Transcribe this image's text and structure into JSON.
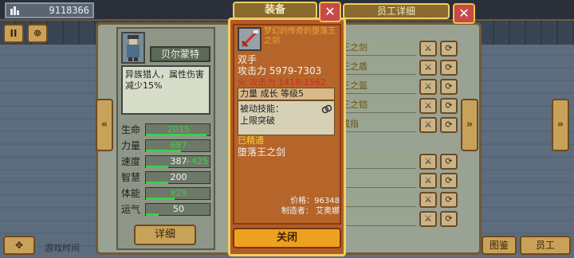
{
  "topbar": {
    "gold": "9118366",
    "gold_icon": "coins-icon"
  },
  "left_buttons": {
    "pause": "II",
    "settings": "☸"
  },
  "hero": {
    "name": "贝尔蒙特",
    "desc": "异族猎人，属性伤害减少15%",
    "stats": [
      {
        "label": "生命",
        "value": "2015",
        "fill": 0.95,
        "value_color": "#3bd04a",
        "bonus": ""
      },
      {
        "label": "力量",
        "value": "687",
        "fill": 0.55,
        "value_color": "#3bd04a",
        "bonus": ""
      },
      {
        "label": "速度",
        "value": "387",
        "fill": 0.35,
        "value_color": "#f2f2f2",
        "bonus": "+425"
      },
      {
        "label": "智慧",
        "value": "200",
        "fill": 0.35,
        "value_color": "#f2f2f2",
        "bonus": ""
      },
      {
        "label": "体能",
        "value": "829",
        "fill": 0.45,
        "value_color": "#3bd04a",
        "bonus": ""
      },
      {
        "label": "运气",
        "value": "50",
        "fill": 0.2,
        "value_color": "#f2f2f2",
        "bonus": ""
      }
    ],
    "detail_button": "详细"
  },
  "header": {
    "title": "员工详细"
  },
  "equip_rows": [
    {
      "text": "王之剑"
    },
    {
      "text": "王之盾"
    },
    {
      "text": "王之盔"
    },
    {
      "text": "王之铠"
    },
    {
      "text": "戒指"
    },
    {
      "text": ""
    },
    {
      "text": ""
    },
    {
      "text": ""
    },
    {
      "text": ""
    },
    {
      "text": ""
    }
  ],
  "bottom": {
    "left_hint": "游戏时间",
    "gallery": "图鉴",
    "staff": "员工"
  },
  "popup": {
    "title": "装备",
    "item_name": "梦幻的传奇的堕落王之剑",
    "hand": "双手",
    "attack": "攻击力  5979-7303",
    "fire_attack": "火 攻击力  1418-1562",
    "row_stats": "力量  成长  等级5",
    "passive_label": "被动技能：",
    "passive_skill": "上限突破",
    "mastered": "已精通",
    "mastered_item": "堕落王之剑",
    "price": "价格：96348",
    "maker": "制造者：  艾奥娜",
    "close_button": "关闭"
  }
}
